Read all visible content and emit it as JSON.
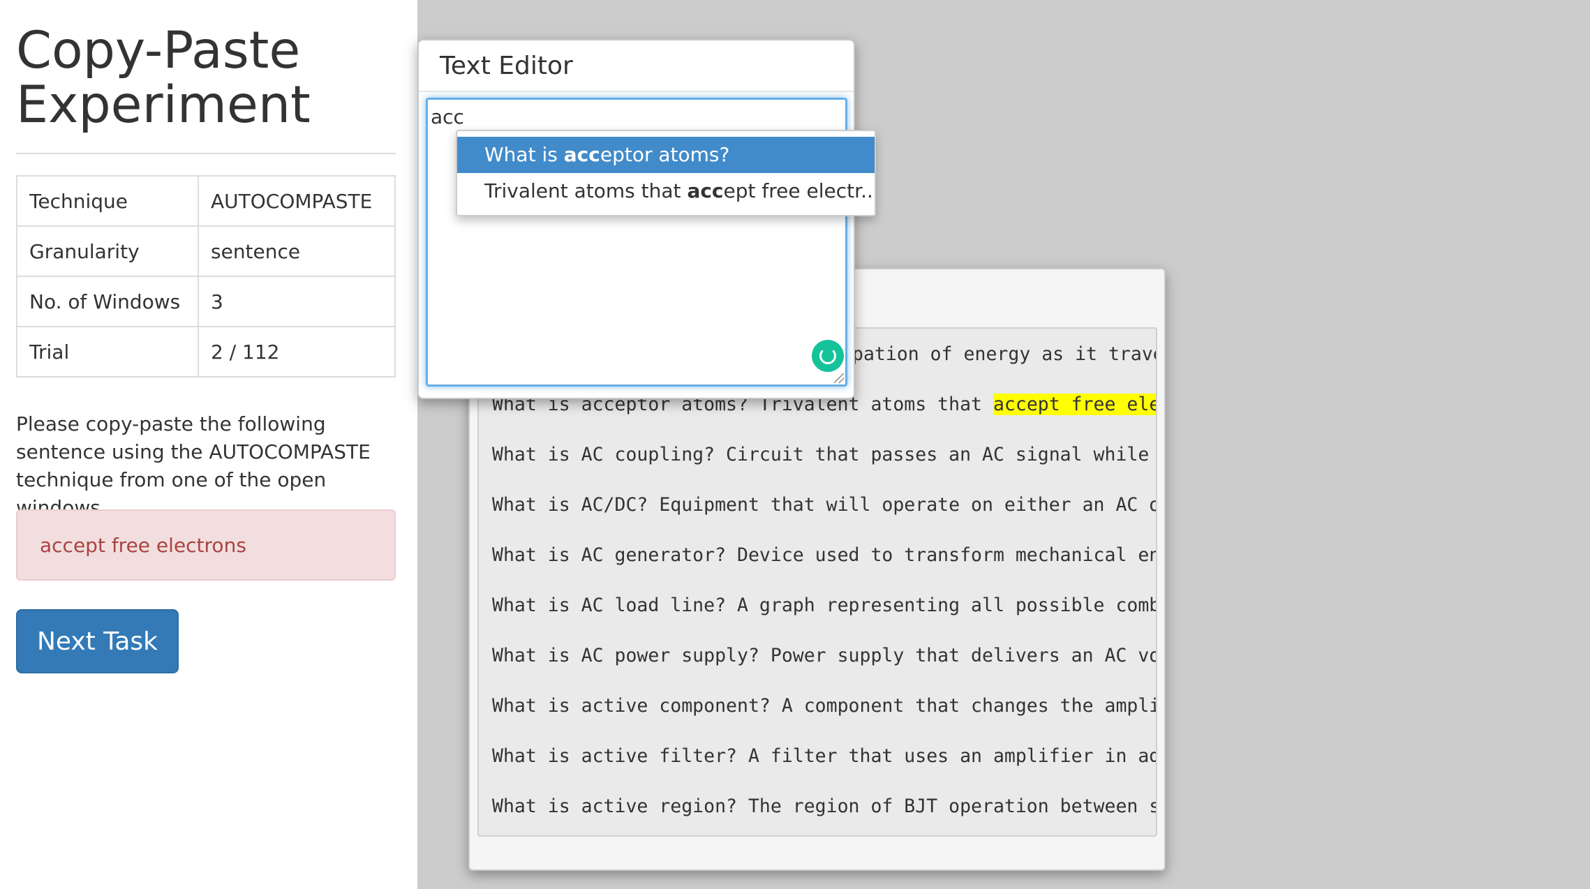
{
  "left": {
    "title": "Copy-Paste Experiment",
    "table": [
      {
        "key": "Technique",
        "value": "AUTOCOMPASTE"
      },
      {
        "key": "Granularity",
        "value": "sentence"
      },
      {
        "key": "No. of Windows",
        "value": "3"
      },
      {
        "key": "Trial",
        "value": "2 / 112"
      }
    ],
    "instruction": "Please copy-paste the following sentence using the AUTOCOMPASTE technique from one of the open windows.",
    "target_text": "accept free electrons",
    "next_button": "Next Task"
  },
  "editor": {
    "title": "Text Editor",
    "value": "acc",
    "suggestions": [
      {
        "prefix": "What is ",
        "match": "acc",
        "suffix": "eptor atoms?"
      },
      {
        "prefix": "Trivalent atoms that ",
        "match": "acc",
        "suffix": "ept free electr..."
      }
    ]
  },
  "reference": {
    "lines": [
      {
        "pre": "",
        "text": "pation of energy as it trave"
      },
      {
        "pre": "What is acceptor atoms? Trivalent atoms that ",
        "highlight": "accept free elec"
      },
      {
        "pre": "What is AC coupling? Circuit that passes an AC signal while b"
      },
      {
        "pre": "What is AC/DC? Equipment that will operate on either an AC or"
      },
      {
        "pre": "What is AC generator? Device used to transform mechanical ene"
      },
      {
        "pre": "What is AC load line? A graph representing all possible combi"
      },
      {
        "pre": "What is AC power supply? Power supply that delivers an AC vol"
      },
      {
        "pre": "What is active component? A component that changes the amplit"
      },
      {
        "pre": "What is active filter? A filter that uses an amplifier in add"
      },
      {
        "pre": "What is active region? The region of BJT operation between sa"
      }
    ]
  },
  "colors": {
    "primary": "#337ab7",
    "alert_bg": "#f2dede",
    "alert_text": "#a94442",
    "highlight": "#ffff00",
    "suggest_active": "#428bca"
  }
}
